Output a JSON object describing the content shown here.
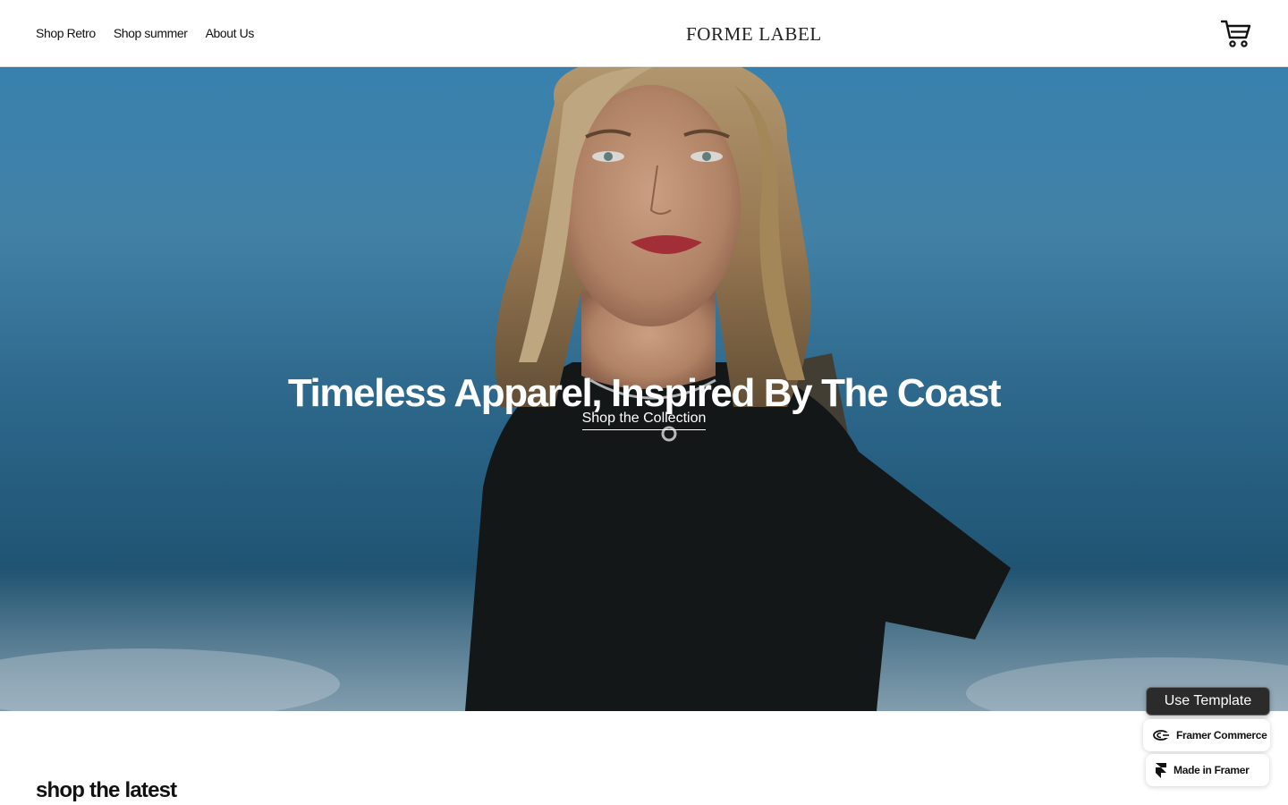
{
  "header": {
    "nav": [
      {
        "label": "Shop Retro"
      },
      {
        "label": "Shop summer"
      },
      {
        "label": "About Us"
      }
    ],
    "brand": "FORME LABEL",
    "cart_icon": "shopping-cart-icon"
  },
  "hero": {
    "title": "Timeless Apparel, Inspired By The Coast",
    "cta_label": "Shop the Collection",
    "image": "woman-portrait-sky-photo"
  },
  "section": {
    "title": "shop the latest"
  },
  "floating": {
    "use_template_label": "Use Template",
    "commerce_badge": "Framer Commerce",
    "commerce_icon": "framer-commerce-logo-icon",
    "framer_badge": "Made in Framer",
    "framer_icon": "framer-logo-icon"
  },
  "colors": {
    "sky_top": "#3f8fc1",
    "sky_bottom": "#235a7b",
    "text_dark": "#111111",
    "button_dark": "#2b2b2b"
  }
}
